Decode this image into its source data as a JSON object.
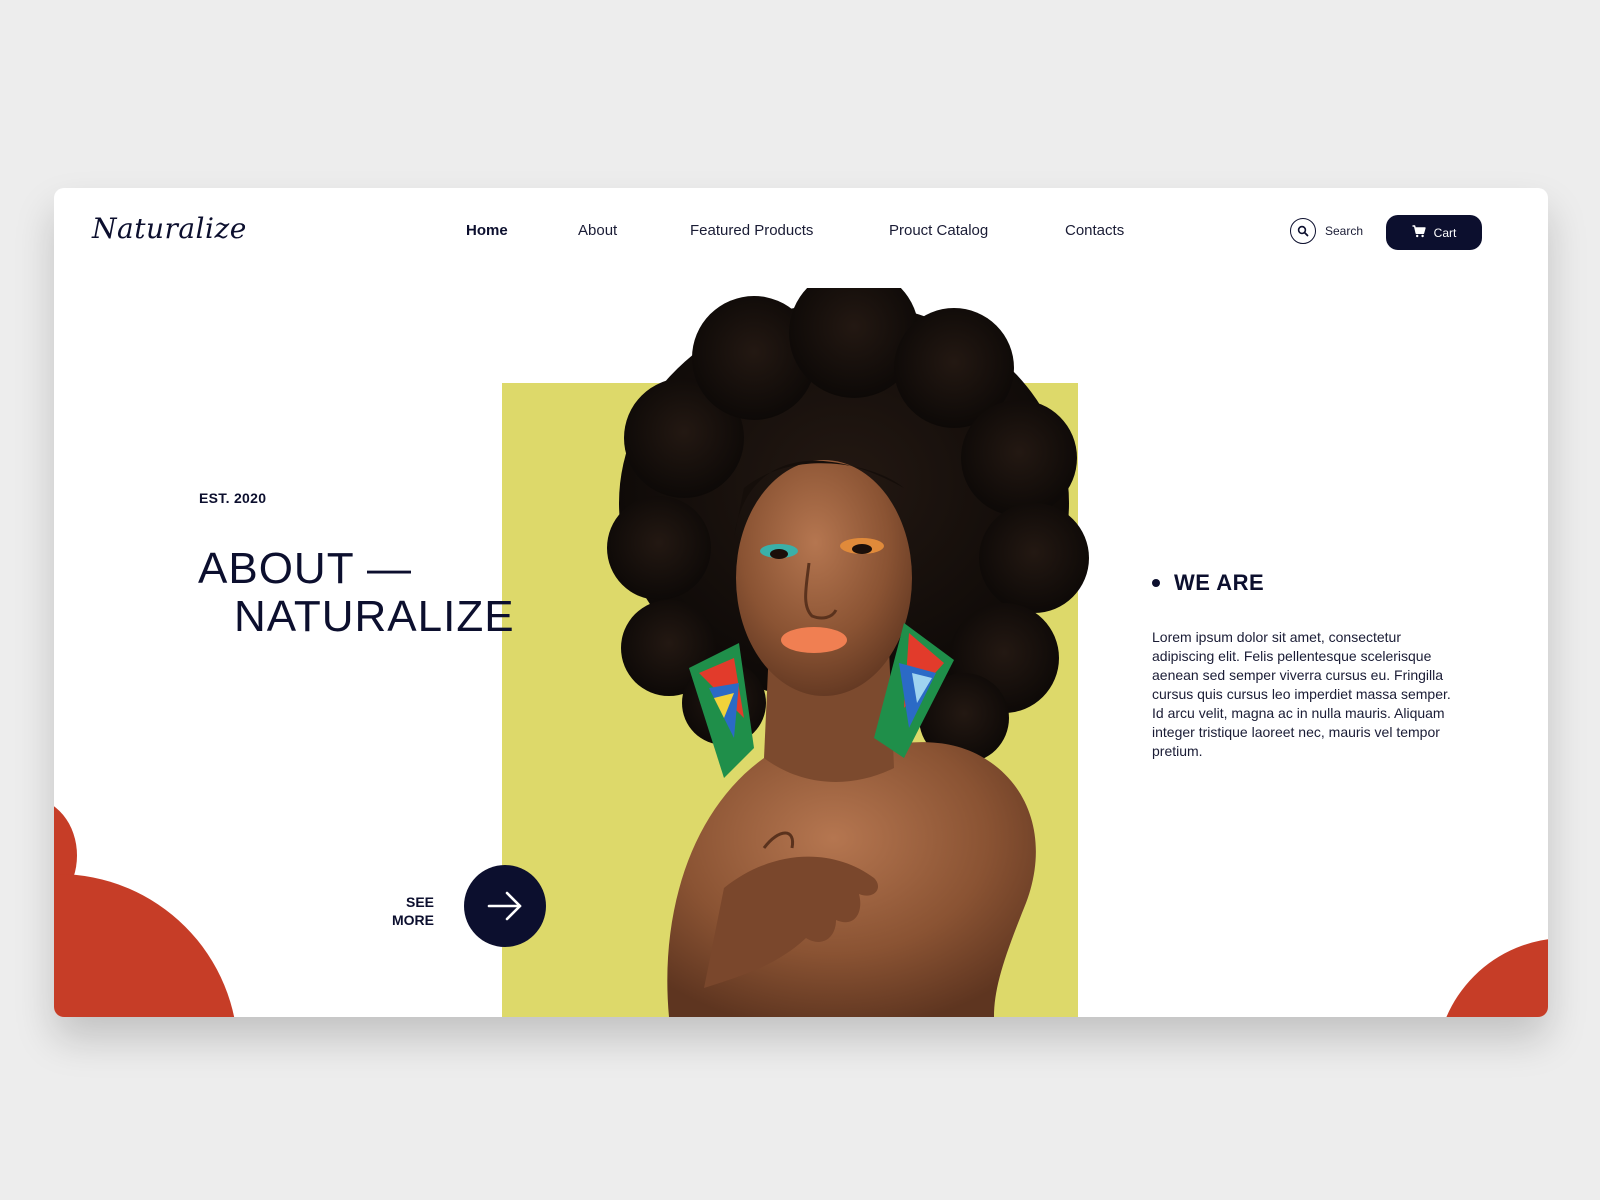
{
  "brand": {
    "logo": "Naturalize"
  },
  "nav": {
    "items": [
      {
        "label": "Home",
        "active": true
      },
      {
        "label": "About",
        "active": false
      },
      {
        "label": "Featured Products",
        "active": false
      },
      {
        "label": "Prouct Catalog",
        "active": false
      },
      {
        "label": "Contacts",
        "active": false
      }
    ]
  },
  "search": {
    "label": "Search",
    "icon": "search-icon"
  },
  "cart": {
    "label": "Cart",
    "icon": "cart-icon"
  },
  "hero": {
    "established": "EST. 2020",
    "title_line1": "ABOUT —",
    "title_line2": "NATURALIZE",
    "see_more_line1": "SEE",
    "see_more_line2": "MORE",
    "see_more_icon": "arrow-right-icon",
    "portrait_icon": "portrait-photo"
  },
  "about": {
    "heading": "WE ARE",
    "text": "Lorem ipsum dolor sit amet, consectetur adipiscing elit. Felis pellentesque scelerisque aenean sed semper viverra cursus eu. Fringilla cursus quis cursus leo imperdiet massa semper. Id arcu velit, magna ac in nulla mauris. Aliquam integer tristique laoreet nec, mauris vel tempor pretium."
  },
  "colors": {
    "navy": "#0c0f2e",
    "accent_yellow": "#ddd96a",
    "accent_red": "#c63d27",
    "background": "#ededed"
  }
}
